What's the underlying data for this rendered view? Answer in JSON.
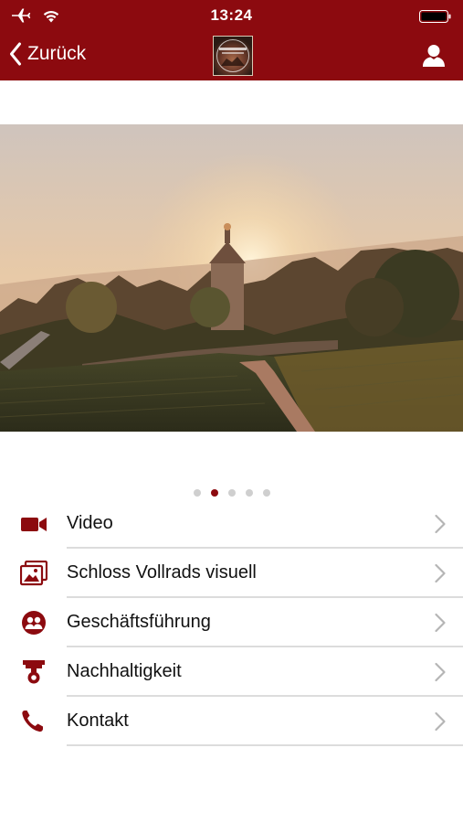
{
  "status_bar": {
    "time": "13:24",
    "icons": [
      "airplane-icon",
      "wifi-icon",
      "battery-icon"
    ]
  },
  "nav": {
    "back_label": "Zurück",
    "back_icon": "chevron-left-icon",
    "logo_icon": "schloss-vollrads-logo",
    "user_icon": "user-icon"
  },
  "carousel": {
    "image": "aerial-vineyard-castle-sunrise",
    "page_count": 5,
    "active_page": 2
  },
  "menu": {
    "items": [
      {
        "label": "Video",
        "icon": "video-camera-icon"
      },
      {
        "label": "Schloss Vollrads visuell",
        "icon": "photo-gallery-icon"
      },
      {
        "label": "Geschäftsführung",
        "icon": "people-icon"
      },
      {
        "label": "Nachhaltigkeit",
        "icon": "sustainability-icon"
      },
      {
        "label": "Kontakt",
        "icon": "phone-icon"
      }
    ]
  },
  "colors": {
    "brand": "#8c0a0f",
    "separator": "#dcdcdc",
    "dot_inactive": "#cfcfcf",
    "chevron": "#b5b5b5"
  }
}
